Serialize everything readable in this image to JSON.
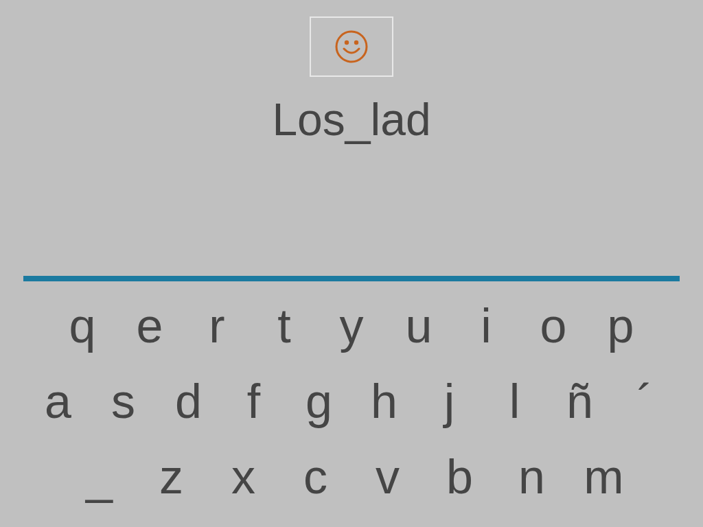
{
  "word": "Los_lad",
  "keyboard": {
    "rows": [
      [
        "q",
        "e",
        "r",
        "t",
        "y",
        "u",
        "i",
        "o",
        "p"
      ],
      [
        "a",
        "s",
        "d",
        "f",
        "g",
        "h",
        "j",
        "l",
        "ñ",
        "´"
      ],
      [
        "_",
        "z",
        "x",
        "c",
        "v",
        "b",
        "n",
        "m"
      ]
    ]
  }
}
